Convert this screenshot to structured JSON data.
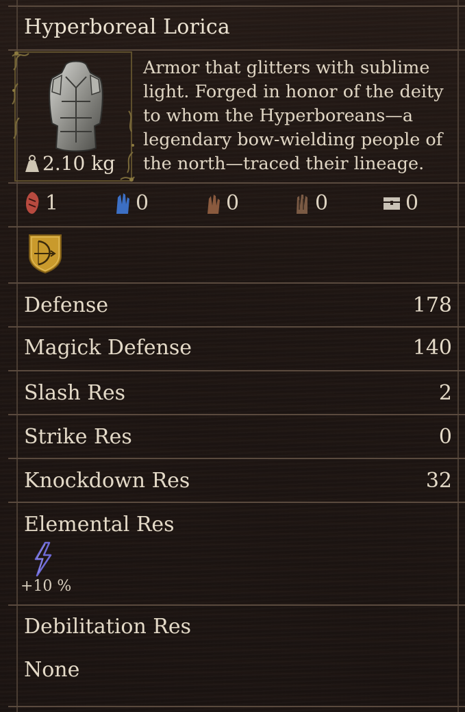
{
  "item": {
    "name": "Hyperboreal Lorica",
    "weight": "2.10 kg",
    "description": "Armor that glitters with sublime light. Forged in honor of the deity to whom the Hyperboreans—a legendary bow-wielding people of the north—traced their lineage.",
    "armor_icon": "armor-chestpiece-icon"
  },
  "vocations": [
    {
      "icon": "fighter-icon",
      "value": "1",
      "color": "#b84a3f"
    },
    {
      "icon": "mage-icon",
      "value": "0",
      "color": "#3c6fc4"
    },
    {
      "icon": "thief-icon",
      "value": "0",
      "color": "#8a5a3e"
    },
    {
      "icon": "warrior-icon",
      "value": "0",
      "color": "#7a5a44"
    },
    {
      "icon": "chest-icon",
      "value": "0",
      "color": "#c9c2b6"
    }
  ],
  "equip_icon": "archer-shield-icon",
  "stats": [
    {
      "label": "Defense",
      "value": "178"
    },
    {
      "label": "Magick Defense",
      "value": "140"
    },
    {
      "label": "Slash Res",
      "value": "2"
    },
    {
      "label": "Strike Res",
      "value": "0"
    },
    {
      "label": "Knockdown Res",
      "value": "32"
    }
  ],
  "elemental": {
    "label": "Elemental Res",
    "icon": "lightning-icon",
    "value": "+10 %"
  },
  "debilitation": {
    "label": "Debilitation Res",
    "value": "None"
  },
  "colors": {
    "background": "#1c1512",
    "divider": "#5a4a3e",
    "text": "#e2d8c4",
    "shield_gold": "#c99a2c",
    "lightning": "#6e6ad6"
  }
}
